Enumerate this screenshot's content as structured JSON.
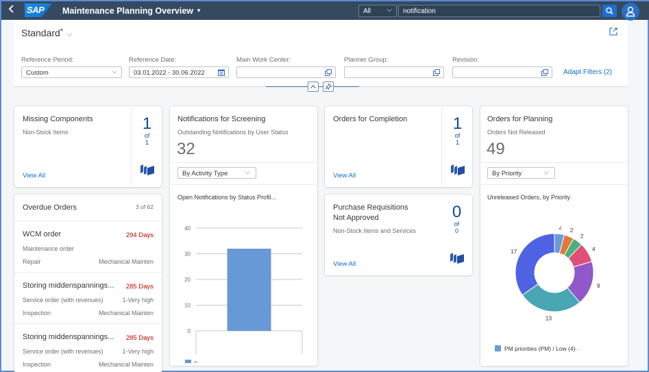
{
  "shell": {
    "app_title": "Maintenance Planning Overview",
    "search_scope": "All",
    "search_value": "notification",
    "brand_color": "#354a5f",
    "logo_text": "SAP"
  },
  "header": {
    "variant": "Standard",
    "variant_modified": "*",
    "filters": [
      {
        "label": "Reference Period:",
        "value": "Custom",
        "type": "select"
      },
      {
        "label": "Reference Date:",
        "value": "03.01.2022 - 30.06.2022",
        "type": "date-range"
      },
      {
        "label": "Main Work Center:",
        "value": "",
        "type": "value-help"
      },
      {
        "label": "Planner Group:",
        "value": "",
        "type": "value-help"
      },
      {
        "label": "Revision:",
        "value": "",
        "type": "value-help"
      }
    ],
    "adapt_filters": "Adapt Filters (2)"
  },
  "cards": {
    "missing_components": {
      "title": "Missing Components",
      "subtitle": "Non-Stock Items",
      "count": "1",
      "of": "of",
      "total": "1",
      "view_all": "View All"
    },
    "notifications": {
      "title": "Notifications for Screening",
      "subtitle": "Outstanding Notifications by User Status",
      "kpi": "32",
      "dropdown": "By Activity Type",
      "chart_title": "Open Notifications by Status Profil..."
    },
    "orders_completion": {
      "title": "Orders for Completion",
      "count": "1",
      "of": "of",
      "total": "1",
      "view_all": "View All"
    },
    "purchase_requisitions": {
      "title_line1": "Purchase Requisitions",
      "title_line2": "Not Approved",
      "subtitle": "Non-Stock Items and Services",
      "count": "0",
      "of": "of",
      "total": "0",
      "view_all": "View All"
    },
    "orders_planning": {
      "title": "Orders for Planning",
      "subtitle": "Orders Not Released",
      "kpi": "49",
      "dropdown": "By Priority",
      "chart_title": "Unreleased Orders, by Priority",
      "legend": "PM priorities (PM) / Low (4)",
      "legend_more": "..."
    },
    "overdue_orders": {
      "title": "Overdue Orders",
      "count": "3 of 62",
      "items": [
        {
          "title": "WCM order",
          "days": "294 Days",
          "type": "Maintenance order",
          "priority": "",
          "activity": "Repair",
          "work_center": "Mechanical Maintenance"
        },
        {
          "title": "Storing middenspannings...",
          "days": "285 Days",
          "type": "Service order (with revenues)",
          "priority": "1-Very high",
          "activity": "Inspection",
          "work_center": "Mechanical Maintenance"
        },
        {
          "title": "Storing middenspannings...",
          "days": "285 Days",
          "type": "Service order (with revenues)",
          "priority": "1-Very high",
          "activity": "Inspection",
          "work_center": "Mechanical Maintenance"
        }
      ]
    }
  },
  "chart_data": [
    {
      "type": "bar",
      "title": "Open Notifications by Status Profil...",
      "categories": [
        ""
      ],
      "series": [
        {
          "name": "0",
          "values": [
            32
          ],
          "color": "#6699d6"
        }
      ],
      "yticks": [
        "0",
        "10",
        "20",
        "30",
        "40"
      ],
      "ylim": [
        0,
        40
      ],
      "grid": true,
      "legend": "bottom-left"
    },
    {
      "type": "pie",
      "donut": true,
      "title": "Unreleased Orders, by Priority",
      "slices": [
        {
          "label": "2",
          "value": 2,
          "color": "#6a9bdb"
        },
        {
          "label": "2",
          "value": 2,
          "color": "#e0793b"
        },
        {
          "label": "2",
          "value": 2,
          "color": "#4caf78"
        },
        {
          "label": "4",
          "value": 4,
          "color": "#e04f77"
        },
        {
          "label": "9",
          "value": 9,
          "color": "#9158c9"
        },
        {
          "label": "13",
          "value": 13,
          "color": "#49a6b3"
        },
        {
          "label": "17",
          "value": 17,
          "color": "#4f62e3"
        }
      ],
      "legend": "bottom-left"
    }
  ]
}
